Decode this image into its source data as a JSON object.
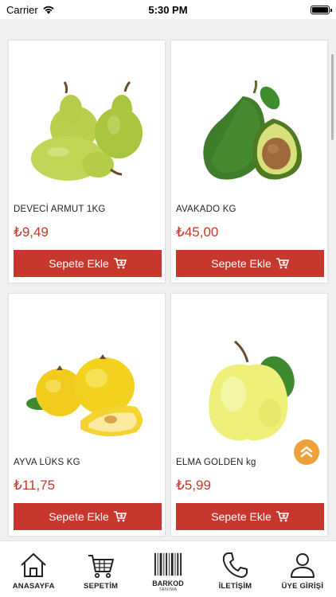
{
  "status": {
    "carrier": "Carrier",
    "time": "5:30 PM"
  },
  "products": [
    {
      "name": "DEVECİ ARMUT 1KG",
      "price": "₺9,49",
      "button": "Sepete Ekle",
      "image": "pear-image"
    },
    {
      "name": "AVAKADO KG",
      "price": "₺45,00",
      "button": "Sepete Ekle",
      "image": "avocado-image"
    },
    {
      "name": "AYVA LÜKS KG",
      "price": "₺11,75",
      "button": "Sepete Ekle",
      "image": "quince-image"
    },
    {
      "name": "ELMA GOLDEN kg",
      "price": "₺5,99",
      "button": "Sepete Ekle",
      "image": "apple-image"
    }
  ],
  "tabs": {
    "home": "ANASAYFA",
    "cart": "SEPETİM",
    "barcode": "BARKOD",
    "barcode_sub": "TANIMA",
    "contact": "İLETİŞİM",
    "login": "ÜYE GİRİŞİ"
  },
  "colors": {
    "accent": "#c8372d",
    "price": "#c0392b",
    "scroll_button": "#f0a03a"
  }
}
